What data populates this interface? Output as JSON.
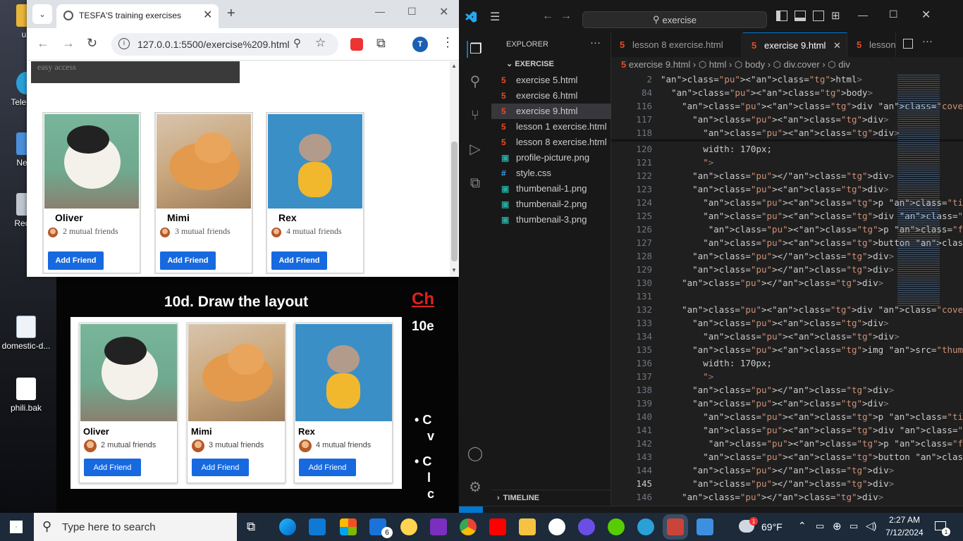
{
  "desktop": {
    "icons": [
      {
        "label": "us",
        "name": "desktop-icon-user-folder"
      },
      {
        "label": "Teleg W",
        "name": "desktop-icon-telegram"
      },
      {
        "label": "Netw",
        "name": "desktop-icon-network"
      },
      {
        "label": "Recyc",
        "name": "desktop-icon-recycle-bin"
      },
      {
        "label": "domestic-d...",
        "name": "desktop-icon-domestic-file"
      },
      {
        "label": "phili.bak",
        "name": "desktop-icon-phili-bak"
      }
    ]
  },
  "browser": {
    "tab_title": "TESFA'S training exercises",
    "url": "127.0.0.1:5500/exercise%209.html",
    "profile_initial": "T",
    "page_partial_text": "easy access",
    "cards": [
      {
        "name": "Oliver",
        "mutual": "2 mutual friends",
        "button": "Add Friend"
      },
      {
        "name": "Mimi",
        "mutual": "3 mutual friends",
        "button": "Add Friend"
      },
      {
        "name": "Rex",
        "mutual": "4 mutual friends",
        "button": "Add Friend"
      }
    ]
  },
  "slide": {
    "title": "10d. Draw the layout",
    "side_red": "Ch",
    "side_white": "10e",
    "bullets": [
      "C",
      "v",
      "C",
      "l",
      "c"
    ],
    "cards": [
      {
        "name": "Oliver",
        "mutual": "2 mutual friends",
        "button": "Add Friend"
      },
      {
        "name": "Mimi",
        "mutual": "3 mutual friends",
        "button": "Add Friend"
      },
      {
        "name": "Rex",
        "mutual": "4 mutual friends",
        "button": "Add Friend"
      }
    ]
  },
  "vscode": {
    "search": "exercise",
    "explorer_title": "EXPLORER",
    "folder": "EXERCISE",
    "files": [
      {
        "name": "exercise 5.html",
        "type": "html"
      },
      {
        "name": "exercise 6.html",
        "type": "html"
      },
      {
        "name": "exercise 9.html",
        "type": "html",
        "active": true
      },
      {
        "name": "lesson 1 exercise.html",
        "type": "html"
      },
      {
        "name": "lesson 8 exercise.html",
        "type": "html"
      },
      {
        "name": "profile-picture.png",
        "type": "png"
      },
      {
        "name": "style.css",
        "type": "css"
      },
      {
        "name": "thumbenail-1.png",
        "type": "png"
      },
      {
        "name": "thumbenail-2.png",
        "type": "png"
      },
      {
        "name": "thumbenail-3.png",
        "type": "png"
      }
    ],
    "timeline": "TIMELINE",
    "tabs": [
      "lesson 8 exercise.html",
      "exercise 9.html",
      "lesson"
    ],
    "breadcrumb": [
      "exercise 9.html",
      "html",
      "body",
      "div.cover",
      "div"
    ],
    "sticky_lines": [
      {
        "n": "2",
        "code": "<html>"
      },
      {
        "n": "84",
        "code": "  <body>"
      },
      {
        "n": "116",
        "code": "    <div class=\"cover\">"
      },
      {
        "n": "117",
        "code": "      <div>"
      },
      {
        "n": "118",
        "code": "        <div>"
      }
    ],
    "lines": [
      {
        "n": "120",
        "code": "        width: 170px;"
      },
      {
        "n": "121",
        "code": "        \">"
      },
      {
        "n": "122",
        "code": "      </div>"
      },
      {
        "n": "123",
        "code": "      <div>"
      },
      {
        "n": "124",
        "code": "        <p class=\"title\">Oliver</p>"
      },
      {
        "n": "125",
        "code": "        <div class=\"profile-picture-friends"
      },
      {
        "n": "126",
        "code": "         <p class=\"friends\">2 mutual friend"
      },
      {
        "n": "127",
        "code": "        <button class=\"add-button\">Add Frie"
      },
      {
        "n": "128",
        "code": "      </div>"
      },
      {
        "n": "129",
        "code": "      </div>"
      },
      {
        "n": "130",
        "code": "    </div>"
      },
      {
        "n": "131",
        "code": ""
      },
      {
        "n": "132",
        "code": "    <div class=\"cover\">"
      },
      {
        "n": "133",
        "code": "      <div>"
      },
      {
        "n": "134",
        "code": "        <div>"
      },
      {
        "n": "135",
        "code": "      <img src=\"thumbenail-2.png\" style=\""
      },
      {
        "n": "136",
        "code": "        width: 170px;"
      },
      {
        "n": "137",
        "code": "        \">"
      },
      {
        "n": "138",
        "code": "      </div>"
      },
      {
        "n": "139",
        "code": "      <div>"
      },
      {
        "n": "140",
        "code": "        <p class=\"title\">Mimi</p>"
      },
      {
        "n": "141",
        "code": "        <div class=\"profile-picture-friends"
      },
      {
        "n": "142",
        "code": "         <p class=\"friends\">3 mutual friend"
      },
      {
        "n": "143",
        "code": "        <button class=\"add-button\">Add Frie"
      },
      {
        "n": "144",
        "code": "      </div>"
      },
      {
        "n": "145",
        "code": "      </div>"
      },
      {
        "n": "146",
        "code": "    </div>"
      }
    ]
  },
  "taskbar": {
    "search_placeholder": "Type here to search",
    "mail_badge": "6",
    "weather": "69°F",
    "weather_badge": "1",
    "time": "2:27 AM",
    "date": "7/12/2024",
    "notif_count": "1"
  }
}
